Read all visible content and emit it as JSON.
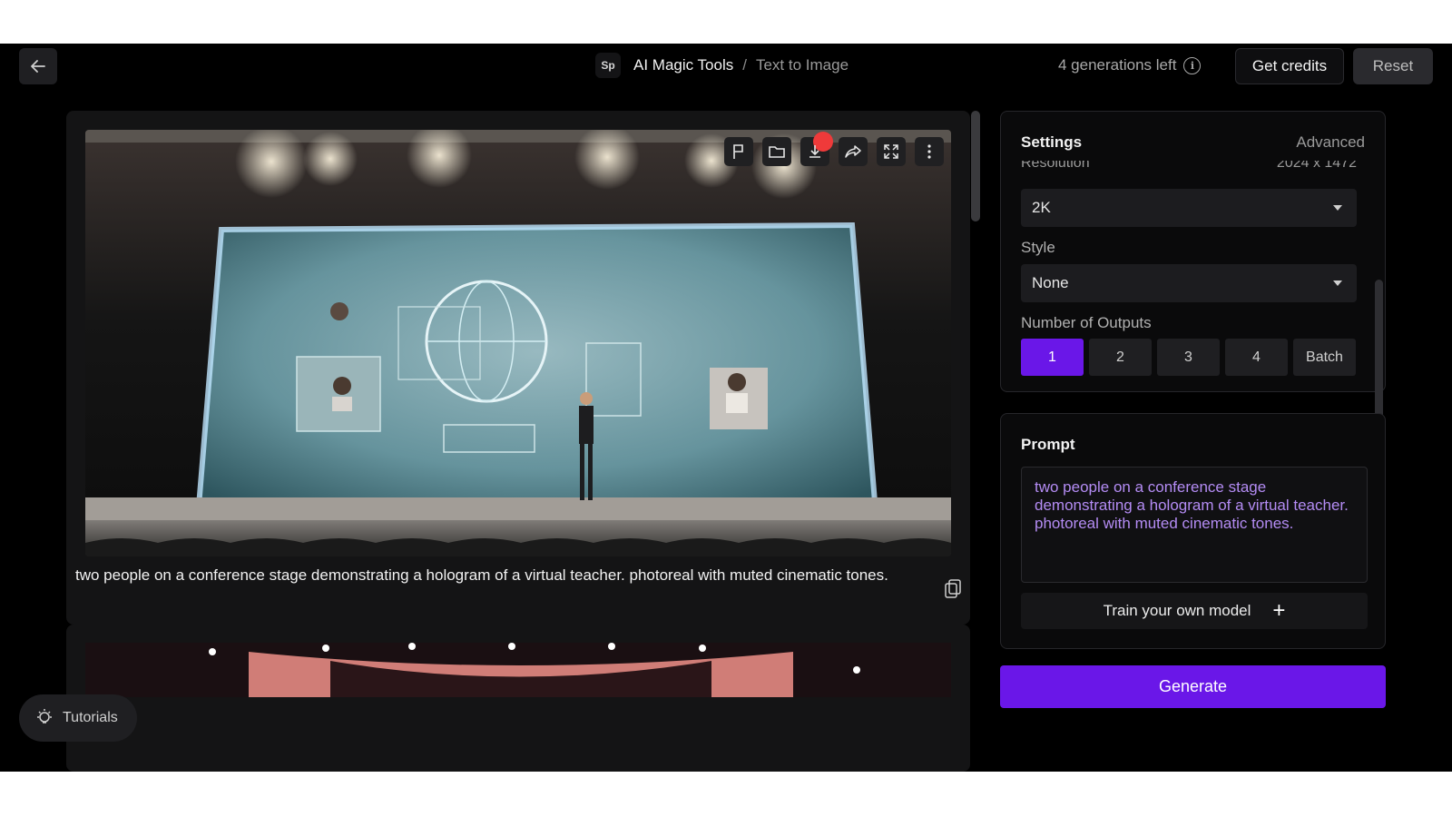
{
  "header": {
    "workspace_badge": "Sp",
    "breadcrumb_main": "AI Magic Tools",
    "breadcrumb_separator": "/",
    "breadcrumb_current": "Text to Image",
    "generations_left": "4 generations left",
    "get_credits_label": "Get credits",
    "reset_label": "Reset"
  },
  "toolbar": {
    "icons": [
      "flag-icon",
      "folder-icon",
      "download-icon",
      "share-icon",
      "expand-icon",
      "more-icon"
    ]
  },
  "result": {
    "caption": "two people on a conference  stage demonstrating a hologram of a virtual teacher. photoreal with muted cinematic tones."
  },
  "tutorials": {
    "label": "Tutorials"
  },
  "settings": {
    "title": "Settings",
    "advanced_label": "Advanced",
    "resolution_label": "Resolution",
    "resolution_value": "2024 x 1472",
    "resolution_selected": "2K",
    "style_label": "Style",
    "style_selected": "None",
    "outputs_label": "Number of Outputs",
    "outputs": [
      "1",
      "2",
      "3",
      "4",
      "Batch"
    ],
    "outputs_selected": "1"
  },
  "prompt": {
    "title": "Prompt",
    "text": "two people on a conference  stage demonstrating a hologram of a virtual teacher. photoreal with muted cinematic tones.",
    "train_label": "Train your own model"
  },
  "generate_label": "Generate",
  "colors": {
    "accent": "#6a17e8",
    "prompt_text": "#b48cf4",
    "panel_bg": "#0a0a0b",
    "app_bg": "#000000"
  }
}
